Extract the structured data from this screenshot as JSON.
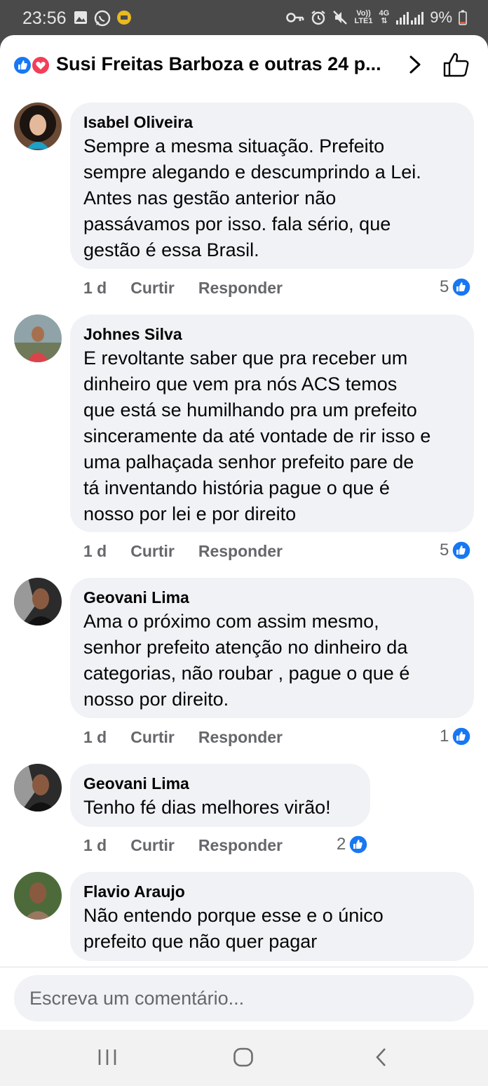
{
  "status_bar": {
    "time": "23:56",
    "battery": "9%",
    "network_top": "Vo))",
    "network_bottom": "LTE1",
    "net_type": "4G",
    "icons": [
      "gallery-icon",
      "whatsapp-icon",
      "notification-icon",
      "key-icon",
      "alarm-icon",
      "mute-icon",
      "signal-icon",
      "battery-icon"
    ]
  },
  "header": {
    "title": "Susi Freitas Barboza e outras 24 p...",
    "icons": [
      "like-reaction-icon",
      "love-reaction-icon",
      "chevron-right-icon",
      "thumbs-up-icon"
    ]
  },
  "comments": [
    {
      "author": "Isabel Oliveira",
      "text": "Sempre a mesma situação. Prefeito\nsempre alegando e descumprindo a Lei.\nAntes nas gestão anterior não\npassávamos por isso.  fala sério, que\ngestão é essa Brasil.",
      "time": "1 d",
      "like_label": "Curtir",
      "reply_label": "Responder",
      "reactions": "5"
    },
    {
      "author": "Johnes Silva",
      "text": "E revoltante saber que pra receber um\ndinheiro que vem pra nós ACS temos\nque está se humilhando pra um prefeito\nsinceramente da até vontade de rir isso e\numa palhaçada senhor prefeito pare de\ntá inventando história pague o que é\nnosso por lei e por direito",
      "time": "1 d",
      "like_label": "Curtir",
      "reply_label": "Responder",
      "reactions": "5"
    },
    {
      "author": "Geovani Lima",
      "text": "Ama o próximo com assim mesmo,\nsenhor prefeito  atenção no dinheiro da\ncategorias, não roubar , pague o que é\nnosso por direito.",
      "time": "1 d",
      "like_label": "Curtir",
      "reply_label": "Responder",
      "reactions": "1"
    },
    {
      "author": "Geovani Lima",
      "text": "Tenho fé dias melhores virão!",
      "time": "1 d",
      "like_label": "Curtir",
      "reply_label": "Responder",
      "reactions": "2"
    },
    {
      "author": "Flavio Araujo",
      "text": "Não entendo porque esse e o único\nprefeito que não quer pagar",
      "time": "",
      "like_label": "",
      "reply_label": "",
      "reactions": ""
    }
  ],
  "composer": {
    "placeholder": "Escreva um comentário..."
  },
  "navbar": {
    "icons": [
      "recents-icon",
      "home-icon",
      "back-icon"
    ]
  },
  "colors": {
    "facebook_blue": "#1877f2",
    "love_red": "#f33e58",
    "bubble_bg": "#f0f2f5",
    "secondary_text": "#65676b"
  }
}
